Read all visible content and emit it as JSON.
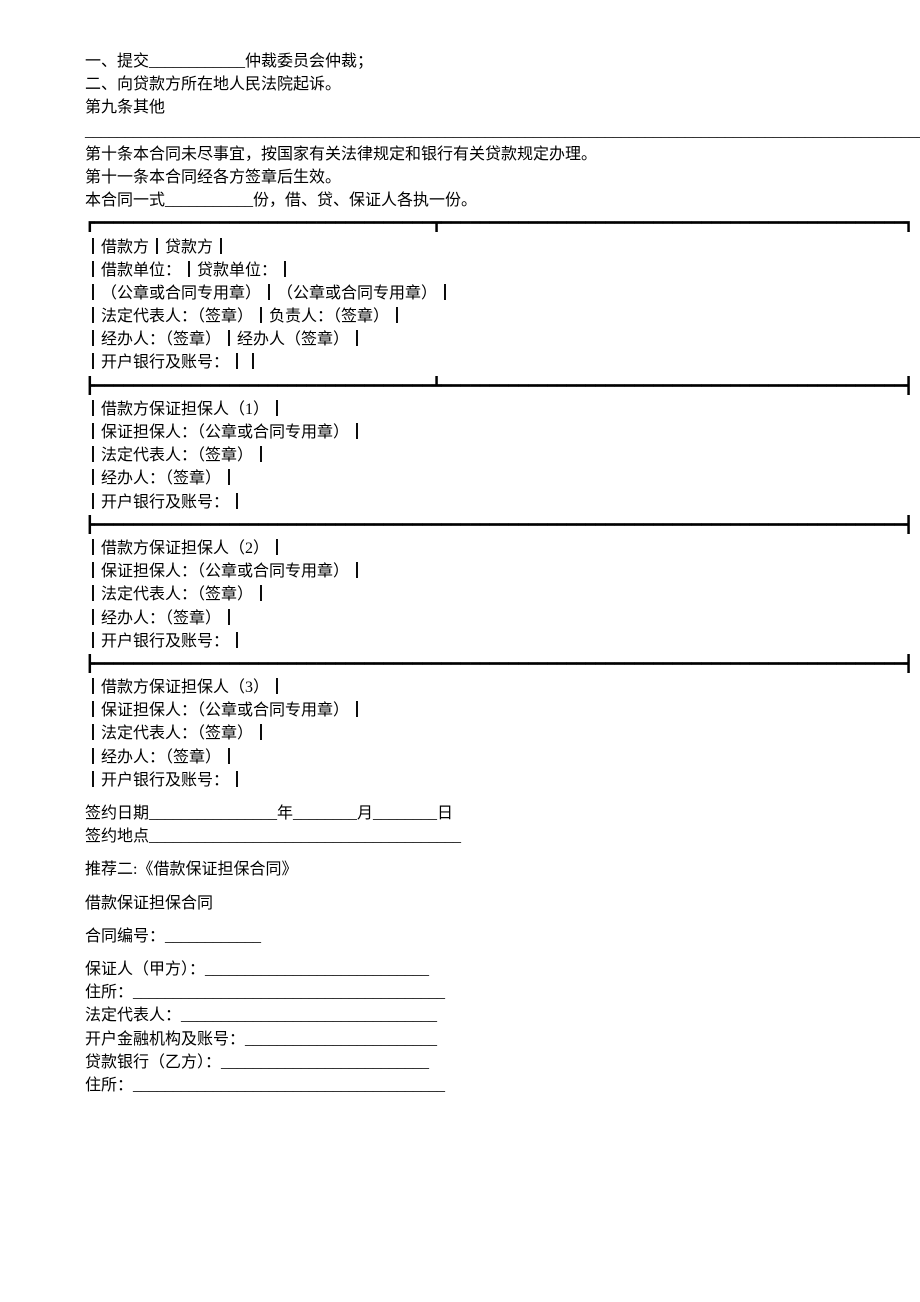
{
  "lines": [
    "一、提交____________仲裁委员会仲裁；",
    "二、向贷款方所在地人民法院起诉。",
    "第九条其他",
    "_______________________________________________________________________________________________________________________________________。",
    "第十条本合同未尽事宜，按国家有关法律规定和银行有关贷款规定办理。",
    "第十一条本合同经各方签章后生效。",
    "本合同一式___________份，借、贷、保证人各执一份。"
  ],
  "table1_top": "┏━━━━━━━━━━━━━━━━━━━━━━━━━━━━━━━━━━━┳━━━━━━━━━━━━━━━━━━━━━━━━━━━━━━━━━━━━━━━━━━━━━━━━┓",
  "table1_rows": [
    "┃借款方┃贷款方┃",
    "┃借款单位：┃贷款单位：┃",
    "┃（公章或合同专用章）┃（公章或合同专用章）┃",
    "┃法定代表人：（签章）┃负责人：（签章）┃",
    "┃经办人：（签章）┃经办人（签章）┃",
    "┃开户银行及账号：┃┃"
  ],
  "table2_top": "┣━━━━━━━━━━━━━━━━━━━━━━━━━━━━━━━━━━━┻━━━━━━━━━━━━━━━━━━━━━━━━━━━━━━━━━━━━━━━━━━━━━━━━┫",
  "table2_rows": [
    "┃借款方保证担保人（1）┃",
    "┃保证担保人：（公章或合同专用章）┃",
    "┃法定代表人：（签章）┃",
    "┃经办人：（签章）┃",
    "┃开户银行及账号：┃"
  ],
  "table3_top": "┣━━━━━━━━━━━━━━━━━━━━━━━━━━━━━━━━━━━━━━━━━━━━━━━━━━━━━━━━━━━━━━━━━━━━━━━━━━━━━━━━━━━━┫",
  "table3_rows": [
    "┃借款方保证担保人（2）┃",
    "┃保证担保人：（公章或合同专用章）┃",
    "┃法定代表人：（签章）┃",
    "┃经办人：（签章）┃",
    "┃开户银行及账号：┃"
  ],
  "table4_top": "┣━━━━━━━━━━━━━━━━━━━━━━━━━━━━━━━━━━━━━━━━━━━━━━━━━━━━━━━━━━━━━━━━━━━━━━━━━━━━━━━━━━━━┫",
  "table4_rows": [
    "┃借款方保证担保人（3）┃",
    "┃保证担保人：（公章或合同专用章）┃",
    "┃法定代表人：（签章）┃",
    "┃经办人：（签章）┃",
    "┃开户银行及账号：┃"
  ],
  "sign": [
    "签约日期________________年________月________日",
    "签约地点_______________________________________"
  ],
  "rec2_heading": "推荐二:《借款保证担保合同》",
  "rec2_title": "借款保证担保合同",
  "rec2_number": "合同编号：____________",
  "rec2_fields": [
    "保证人（甲方）：____________________________",
    "住所：_______________________________________",
    "法定代表人：________________________________",
    "开户金融机构及账号：________________________",
    "贷款银行（乙方）：__________________________",
    "住所：_______________________________________"
  ]
}
